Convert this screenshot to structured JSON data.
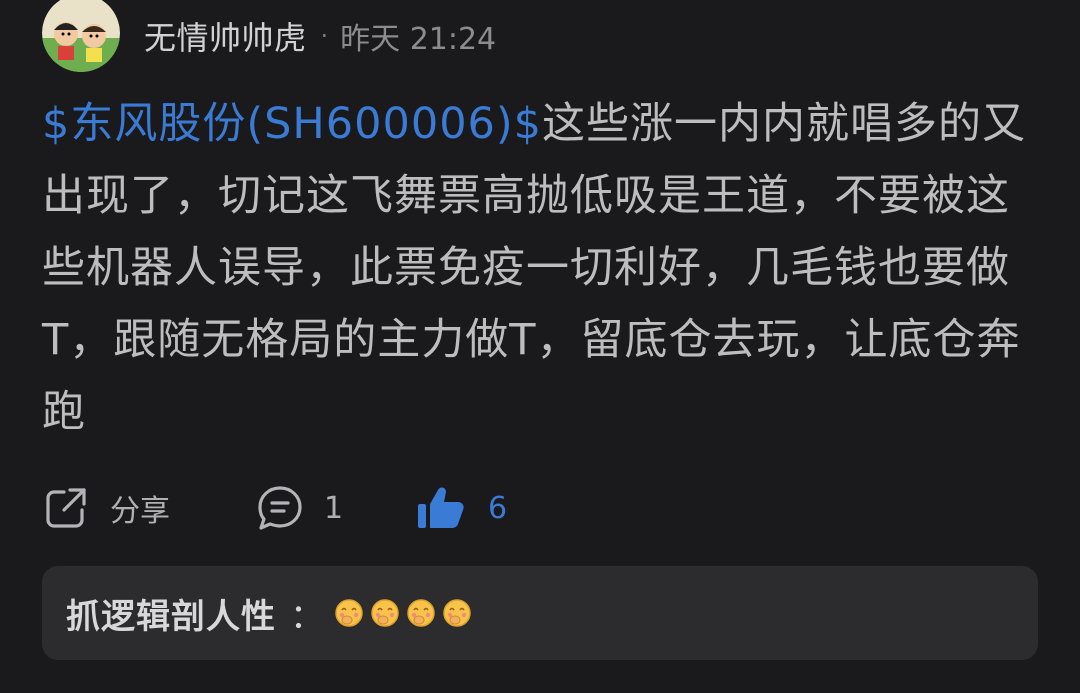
{
  "post": {
    "author": "无情帅帅虎",
    "separator": "·",
    "time": "昨天 21:24",
    "stock_tag": "$东风股份(SH600006)$",
    "content": "这些涨一内内就唱多的又出现了，切记这飞舞票高抛低吸是王道，不要被这些机器人误导，此票免疫一切利好，几毛钱也要做T，跟随无格局的主力做T，留底仓去玩，让底仓奔跑"
  },
  "actions": {
    "share_label": "分享",
    "comment_count": "1",
    "like_count": "6"
  },
  "comment": {
    "author": "抓逻辑剖人性",
    "colon": "：",
    "emojis": [
      "hehe-emoji",
      "hehe-emoji",
      "hehe-emoji",
      "hehe-emoji"
    ]
  },
  "colors": {
    "background": "#1a1a1c",
    "accent": "#3a7bd5",
    "comment_bg": "#2c2c2e"
  }
}
